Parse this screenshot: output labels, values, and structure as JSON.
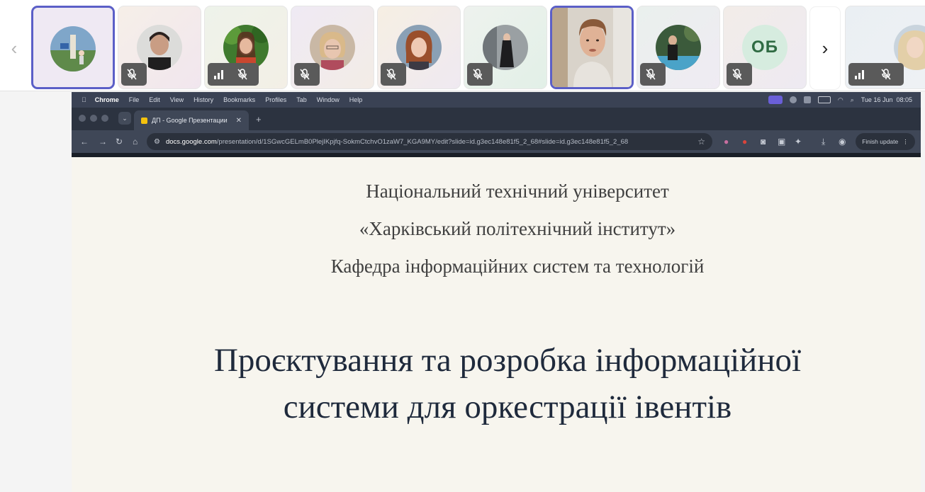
{
  "strip": {
    "prev_icon": "chevron-left-icon",
    "next_icon": "chevron-right-icon",
    "prev_glyph": "‹",
    "next_glyph": "›",
    "participants": [
      {
        "id": "p1",
        "active": true
      },
      {
        "id": "p2",
        "muted": true
      },
      {
        "id": "p3",
        "muted": true,
        "signal": true
      },
      {
        "id": "p4",
        "muted": true
      },
      {
        "id": "p5",
        "muted": true
      },
      {
        "id": "p6",
        "muted": true
      },
      {
        "id": "p7",
        "active": true,
        "video": true
      },
      {
        "id": "p8",
        "muted": true
      },
      {
        "id": "p9",
        "muted": true,
        "initials": "ОБ"
      },
      {
        "id": "p10",
        "muted": true,
        "signal": true
      }
    ],
    "accent_color": "#5b5fc7"
  },
  "mac_menubar": {
    "app": "Chrome",
    "items": [
      "File",
      "Edit",
      "View",
      "History",
      "Bookmarks",
      "Profiles",
      "Tab",
      "Window",
      "Help"
    ],
    "clock": "Tue 16 Jun  08:05"
  },
  "browser": {
    "tab_title": "ДП - Google Презентации",
    "tab_close": "✕",
    "new_tab": "+",
    "url_host": "docs.google.com",
    "url_path": "/presentation/d/1SGwcGELmB0PlejIKpjfq-SokmCtchvO1zaW7_KGA9MY/edit?slide=id.g3ec148e81f5_2_68#slide=id.g3ec148e81f5_2_68",
    "finish_update": "Finish update"
  },
  "slide": {
    "line1": "Національний технічний університет",
    "line2": "«Харківський політехнічний інститут»",
    "line3": "Кафедра інформаційних систем та технологій",
    "title_line1": "Проєктування та розробка інформаційної",
    "title_line2": "системи для оркестрації івентів"
  }
}
